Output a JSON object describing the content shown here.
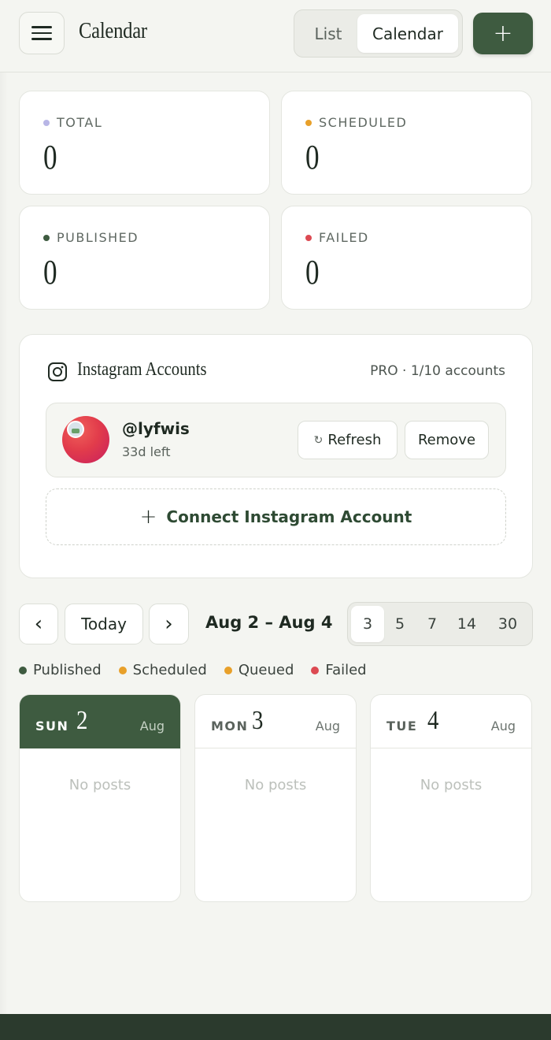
{
  "header": {
    "title": "Calendar",
    "view_options": [
      "List",
      "Calendar"
    ],
    "active_view": "Calendar",
    "add_label": "+"
  },
  "stats": [
    {
      "label": "TOTAL",
      "value": "0",
      "color": "#b8b6e6"
    },
    {
      "label": "SCHEDULED",
      "value": "0",
      "color": "#e8a02a"
    },
    {
      "label": "PUBLISHED",
      "value": "0",
      "color": "#3e5b40"
    },
    {
      "label": "FAILED",
      "value": "0",
      "color": "#dc4a52"
    }
  ],
  "instagram": {
    "title": "Instagram Accounts",
    "plan": "PRO · 1/10 accounts",
    "account": {
      "handle": "@lyfwis",
      "time_left": "33d left",
      "refresh_label": "Refresh",
      "refresh_icon": "↻",
      "remove_label": "Remove"
    },
    "connect_label": "Connect Instagram Account",
    "connect_icon": "+"
  },
  "calendar_nav": {
    "prev_icon": "‹",
    "today_label": "Today",
    "next_icon": "›",
    "range": "Aug 2 – Aug 4",
    "day_options": [
      "3",
      "5",
      "7",
      "14",
      "30"
    ],
    "active_days": "3"
  },
  "legend": [
    {
      "label": "Published",
      "color": "#3e5b40"
    },
    {
      "label": "Scheduled",
      "color": "#e8a02a"
    },
    {
      "label": "Queued",
      "color": "#e8a02a"
    },
    {
      "label": "Failed",
      "color": "#dc4a52"
    }
  ],
  "days": [
    {
      "dow": "SUN",
      "num": "2",
      "month": "Aug",
      "empty": "No posts",
      "today": true
    },
    {
      "dow": "MON",
      "num": "3",
      "month": "Aug",
      "empty": "No posts",
      "today": false
    },
    {
      "dow": "TUE",
      "num": "4",
      "month": "Aug",
      "empty": "No posts",
      "today": false
    }
  ]
}
